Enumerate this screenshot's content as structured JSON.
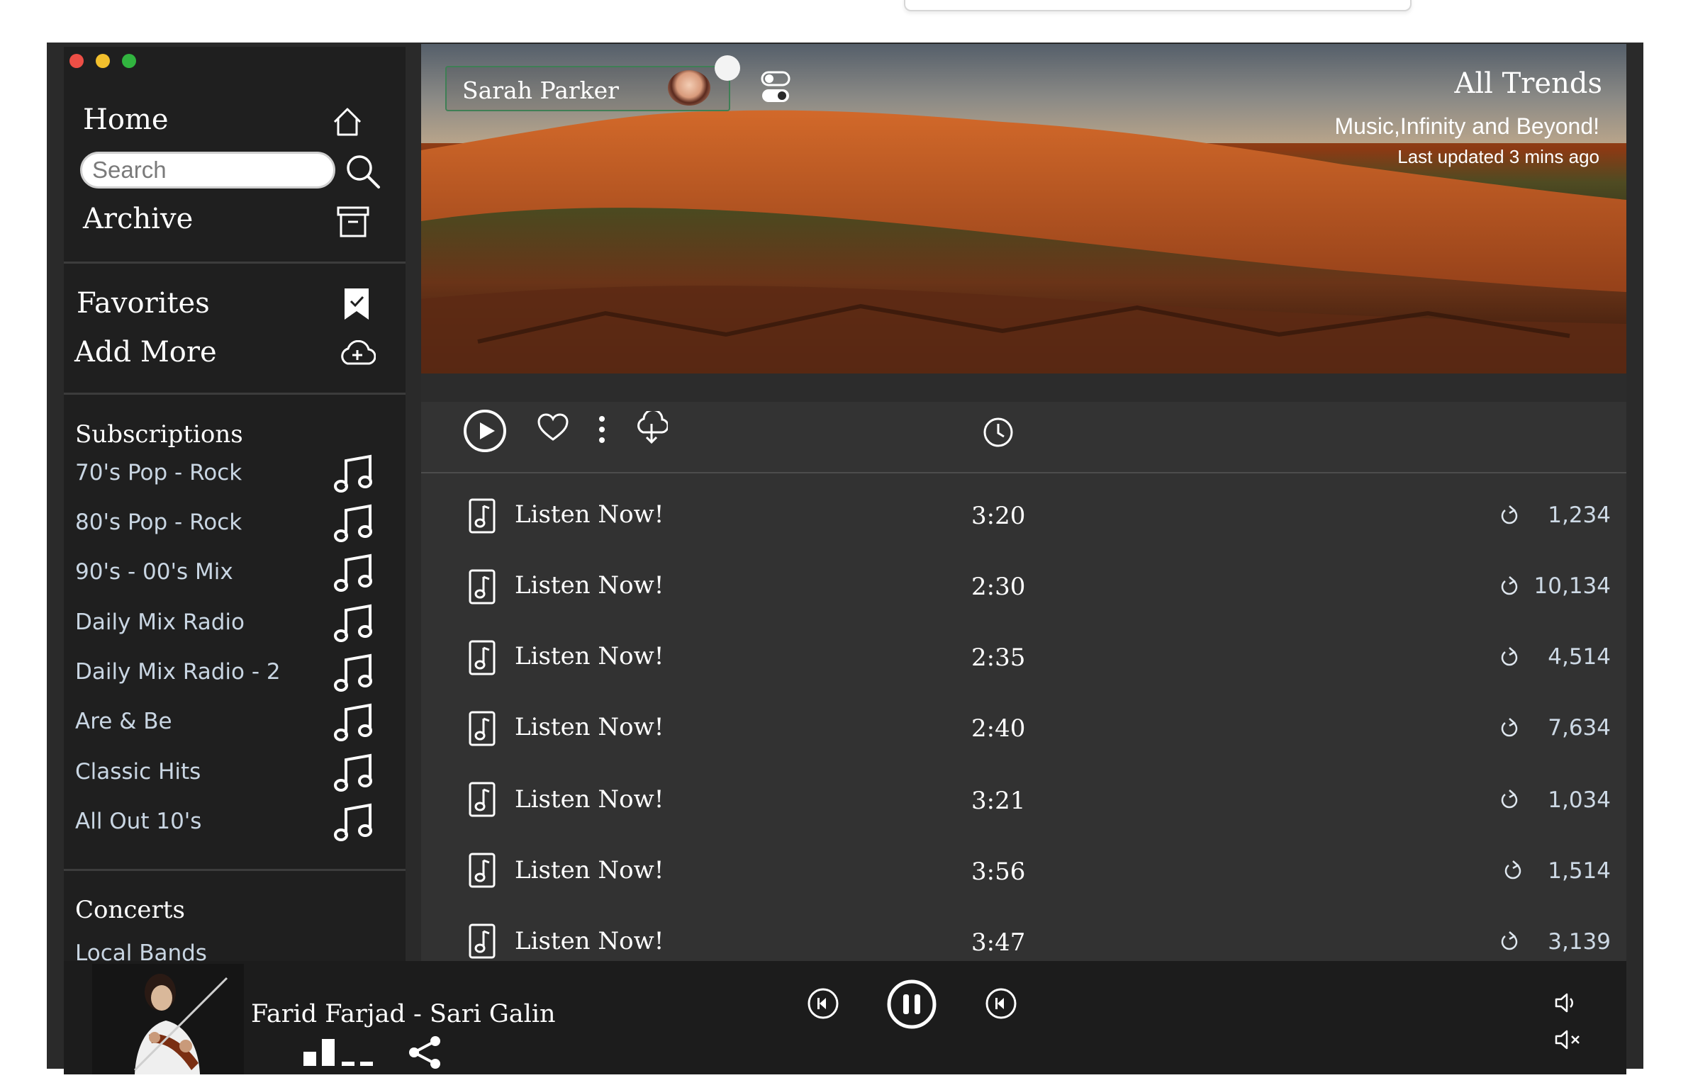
{
  "window_controls": [
    "close",
    "minimize",
    "zoom"
  ],
  "nav": {
    "home": "Home",
    "search_placeholder": "Search",
    "archive": "Archive",
    "favorites": "Favorites",
    "add_more": "Add More"
  },
  "subscriptions": {
    "heading": "Subscriptions",
    "items": [
      {
        "label": "70's Pop - Rock",
        "icon": "music-note-icon"
      },
      {
        "label": "80's Pop - Rock",
        "icon": "music-note-icon"
      },
      {
        "label": "90's - 00's Mix",
        "icon": "music-note-icon"
      },
      {
        "label": "Daily Mix Radio",
        "icon": "music-note-icon"
      },
      {
        "label": "Daily Mix Radio - 2",
        "icon": "music-note-icon"
      },
      {
        "label": "Are & Be",
        "icon": "music-note-icon"
      },
      {
        "label": "Classic Hits",
        "icon": "music-note-icon"
      },
      {
        "label": "All Out 10's",
        "icon": "music-note-icon"
      }
    ]
  },
  "concerts": {
    "heading": "Concerts",
    "items": [
      "Local Bands"
    ]
  },
  "header": {
    "user_name": "Sarah Parker",
    "title": "All Trends",
    "subtitle": "Music,Infinity and Beyond!",
    "updated": "Last updated 3 mins ago"
  },
  "toolbar": {
    "icons": [
      "play-circle-icon",
      "heart-icon",
      "more-vertical-icon",
      "cloud-download-icon",
      "clock-icon"
    ]
  },
  "tracks": [
    {
      "title": "Listen Now!",
      "duration": "3:20",
      "plays": "1,234"
    },
    {
      "title": "Listen Now!",
      "duration": "2:30",
      "plays": "10,134"
    },
    {
      "title": "Listen Now!",
      "duration": "2:35",
      "plays": "4,514"
    },
    {
      "title": "Listen Now!",
      "duration": "2:40",
      "plays": "7,634"
    },
    {
      "title": "Listen Now!",
      "duration": "3:21",
      "plays": "1,034"
    },
    {
      "title": "Listen Now!",
      "duration": "3:56",
      "plays": "1,514"
    },
    {
      "title": "Listen Now!",
      "duration": "3:47",
      "plays": "3,139"
    }
  ],
  "player": {
    "now_playing": "Farid Farjad - Sari Galin",
    "controls": [
      "previous-icon",
      "pause-icon",
      "next-icon",
      "volume-icon",
      "mute-icon"
    ]
  },
  "colors": {
    "sidebar_bg": "#1f1f1f",
    "content_bg": "#323232",
    "subscription_text": "#c9d6e3",
    "user_chip_border": "#3f7f55"
  }
}
